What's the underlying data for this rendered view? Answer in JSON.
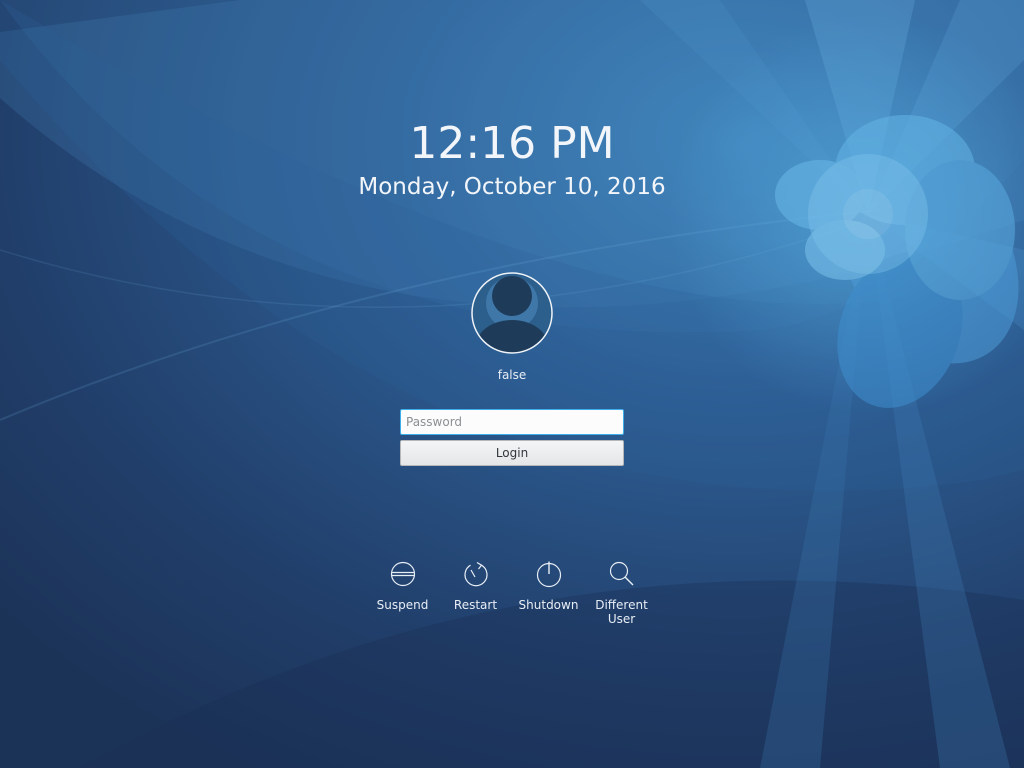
{
  "clock": {
    "time": "12:16 PM",
    "date": "Monday, October 10, 2016"
  },
  "user": {
    "name": "false"
  },
  "login": {
    "password_placeholder": "Password",
    "button_label": "Login"
  },
  "actions": {
    "suspend": {
      "label": "Suspend",
      "icon": "suspend-icon"
    },
    "restart": {
      "label": "Restart",
      "icon": "restart-icon"
    },
    "shutdown": {
      "label": "Shutdown",
      "icon": "shutdown-icon"
    },
    "different_user": {
      "label": "Different User",
      "icon": "search-icon"
    }
  },
  "colors": {
    "background_dark": "#1f3a62",
    "background_light": "#3a7bb5",
    "accent": "#3daee9",
    "text": "#f2f5f9"
  }
}
